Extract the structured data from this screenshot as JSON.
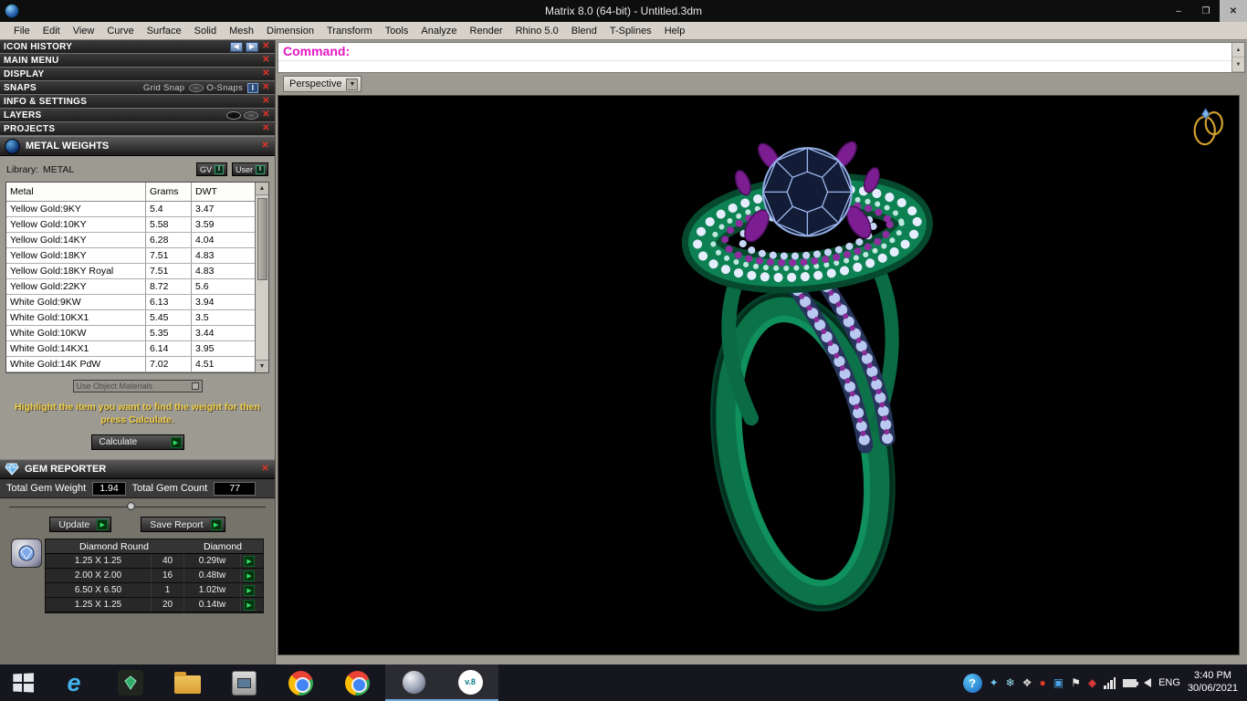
{
  "window": {
    "title": "Matrix 8.0 (64-bit) - Untitled.3dm",
    "controls": {
      "minimize": "–",
      "maximize": "❐",
      "close": "✕"
    }
  },
  "menubar": {
    "items": [
      "File",
      "Edit",
      "View",
      "Curve",
      "Surface",
      "Solid",
      "Mesh",
      "Dimension",
      "Transform",
      "Tools",
      "Analyze",
      "Render",
      "Rhino 5.0",
      "Blend",
      "T-Splines",
      "Help"
    ]
  },
  "sidebar": {
    "icon_history": {
      "label": "ICON HISTORY"
    },
    "main_menu": {
      "label": "MAIN MENU"
    },
    "display": {
      "label": "DISPLAY"
    },
    "snaps": {
      "label": "SNAPS",
      "grid_snap": "Grid Snap",
      "o_snaps": "O-Snaps",
      "indicator": "I"
    },
    "info_settings": {
      "label": "INFO & SETTINGS"
    },
    "layers": {
      "label": "LAYERS"
    },
    "projects": {
      "label": "PROJECTS"
    },
    "metal_weights": {
      "title": "METAL WEIGHTS",
      "library_label": "Library:",
      "library_value": "METAL",
      "gv_button": "GV",
      "user_button": "User",
      "indicator": "I",
      "columns": [
        "Metal",
        "Grams",
        "DWT"
      ],
      "rows": [
        [
          "Yellow Gold:9KY",
          "5.4",
          "3.47"
        ],
        [
          "Yellow Gold:10KY",
          "5.58",
          "3.59"
        ],
        [
          "Yellow Gold:14KY",
          "6.28",
          "4.04"
        ],
        [
          "Yellow Gold:18KY",
          "7.51",
          "4.83"
        ],
        [
          "Yellow Gold:18KY Royal",
          "7.51",
          "4.83"
        ],
        [
          "Yellow Gold:22KY",
          "8.72",
          "5.6"
        ],
        [
          "White Gold:9KW",
          "6.13",
          "3.94"
        ],
        [
          "White Gold:10KX1",
          "5.45",
          "3.5"
        ],
        [
          "White Gold:10KW",
          "5.35",
          "3.44"
        ],
        [
          "White Gold:14KX1",
          "6.14",
          "3.95"
        ],
        [
          "White Gold:14K PdW",
          "7.02",
          "4.51"
        ]
      ],
      "use_object_materials": "Use Object Materials",
      "hint": "Highlight the item you want to find the weight for then press Calculate.",
      "calculate_button": "Calculate"
    },
    "gem_reporter": {
      "title": "GEM REPORTER",
      "total_gem_weight_label": "Total Gem Weight",
      "total_gem_weight": "1.94",
      "total_gem_count_label": "Total Gem Count",
      "total_gem_count": "77",
      "update_button": "Update",
      "save_report_button": "Save Report",
      "table_headers": [
        "Diamond Round",
        "Diamond"
      ],
      "gem_rows": [
        {
          "size": "1.25 X 1.25",
          "count": "40",
          "weight": "0.29tw"
        },
        {
          "size": "2.00 X 2.00",
          "count": "16",
          "weight": "0.48tw"
        },
        {
          "size": "6.50 X 6.50",
          "count": "1",
          "weight": "1.02tw"
        },
        {
          "size": "1.25 X 1.25",
          "count": "20",
          "weight": "0.14tw"
        }
      ]
    }
  },
  "viewport": {
    "command_label": "Command:",
    "view_name": "Perspective"
  },
  "taskbar": {
    "v8_label": "v.8",
    "language": "ENG",
    "time": "3:40 PM",
    "date": "30/06/2021"
  }
}
